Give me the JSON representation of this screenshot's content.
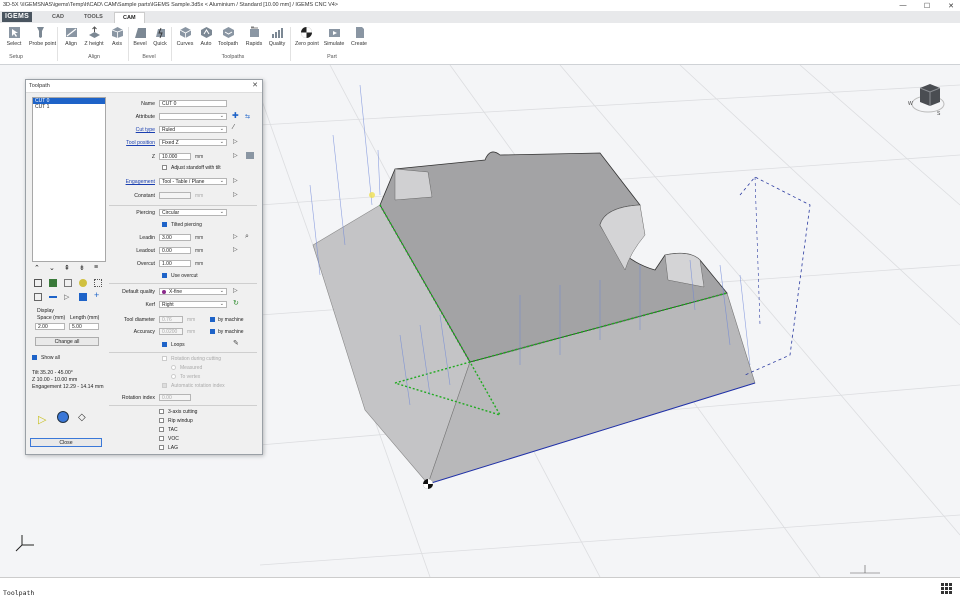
{
  "window": {
    "title": "3D-5X \\\\IGEMSNAS\\igems\\Temp\\It\\CAD\\ CAM\\Sample parts\\IGEMS Sample.3d5x  < Aluminium / Standard [10.00 mm] / IGEMS CNC V4>",
    "minimize": "—",
    "maximize": "☐",
    "close": "✕"
  },
  "tabs": {
    "logo": "IGEMS",
    "items": [
      "CAD",
      "TOOLS",
      "CAM"
    ],
    "active": "CAM"
  },
  "ribbon": {
    "buttons": [
      "Select",
      "Probe point",
      "Align",
      "Z height",
      "Axis",
      "Bevel",
      "Quick",
      "Curves",
      "Auto",
      "Toolpath",
      "Rapids",
      "Quality",
      "Zero point",
      "Simulate",
      "Create"
    ],
    "groups": [
      "Setup",
      "Align",
      "Bevel",
      "Toolpaths",
      "Part"
    ]
  },
  "viewcube": {
    "label": "W",
    "face": "S"
  },
  "dialog": {
    "title": "Toolpath",
    "close": "✕",
    "cuts": [
      "CUT 0",
      "CUT 1"
    ],
    "selected_cut": "CUT 0",
    "fields": {
      "name_label": "Name",
      "name_value": "CUT 0",
      "attribute_label": "Attribute",
      "cut_type_label": "Cut type",
      "cut_type_value": "Ruled",
      "tool_position_label": "Tool position",
      "tool_position_value": "Fixed Z",
      "z_label": "Z",
      "z_value": "10.000",
      "z_unit": "mm",
      "adjust_standoff": "Adjust standoff with tilt",
      "engagement_label": "Engagement",
      "engagement_value": "Tool - Table / Plane",
      "constant_label": "Constant",
      "constant_unit": "mm",
      "piercing_label": "Piercing",
      "piercing_value": "Circular",
      "tilted_piercing": "Tilted piercing",
      "leadin_label": "Leadin",
      "leadin_value": "3.00",
      "leadin_unit": "mm",
      "leadout_label": "Leadout",
      "leadout_value": "0.00",
      "leadout_unit": "mm",
      "overcut_label": "Overcut",
      "overcut_value": "1.00",
      "overcut_unit": "mm",
      "use_overcut": "Use overcut",
      "default_quality_label": "Default quality",
      "default_quality_value": "X-fine",
      "kerf_label": "Kerf",
      "kerf_value": "Right",
      "tool_diameter_label": "Tool diameter",
      "tool_diameter_value": "0.76",
      "tool_diameter_unit": "mm",
      "by_machine_1": "by machine",
      "accuracy_label": "Accuracy",
      "accuracy_value": "0.0200",
      "accuracy_unit": "mm",
      "by_machine_2": "by machine",
      "loops": "Loops",
      "rotation_during_cutting": "Rotation during cutting",
      "measured": "Measured",
      "to_vertex": "To vertex",
      "automatic_rotation_index": "Automatic rotation index",
      "rotation_index_label": "Rotation index",
      "rotation_index_value": "0.00",
      "three_axis_cutting": "3-axis cutting",
      "rip_windup": "Rip windup",
      "tac": "TAC",
      "voc": "VOC",
      "lag": "LAG"
    },
    "display": {
      "label": "Display",
      "space_label": "Space (mm)",
      "space_value": "2.00",
      "length_label": "Length (mm)",
      "length_value": "5.00",
      "change_all": "Change all",
      "show_all": "Show all"
    },
    "info": {
      "tilt": "Tilt 35.20 - 45.00°",
      "z": "Z 10.00 - 10.00 mm",
      "engagement": "Engagement 12.29 - 14.14 mm"
    },
    "close_button": "Close"
  },
  "status": {
    "text": "Toolpath"
  },
  "colors": {
    "accent": "#1e63c8",
    "link": "#1a3fb0",
    "green_path": "#22aa22",
    "part_top": "#9a9a9a",
    "part_side": "#b3b3b3"
  }
}
